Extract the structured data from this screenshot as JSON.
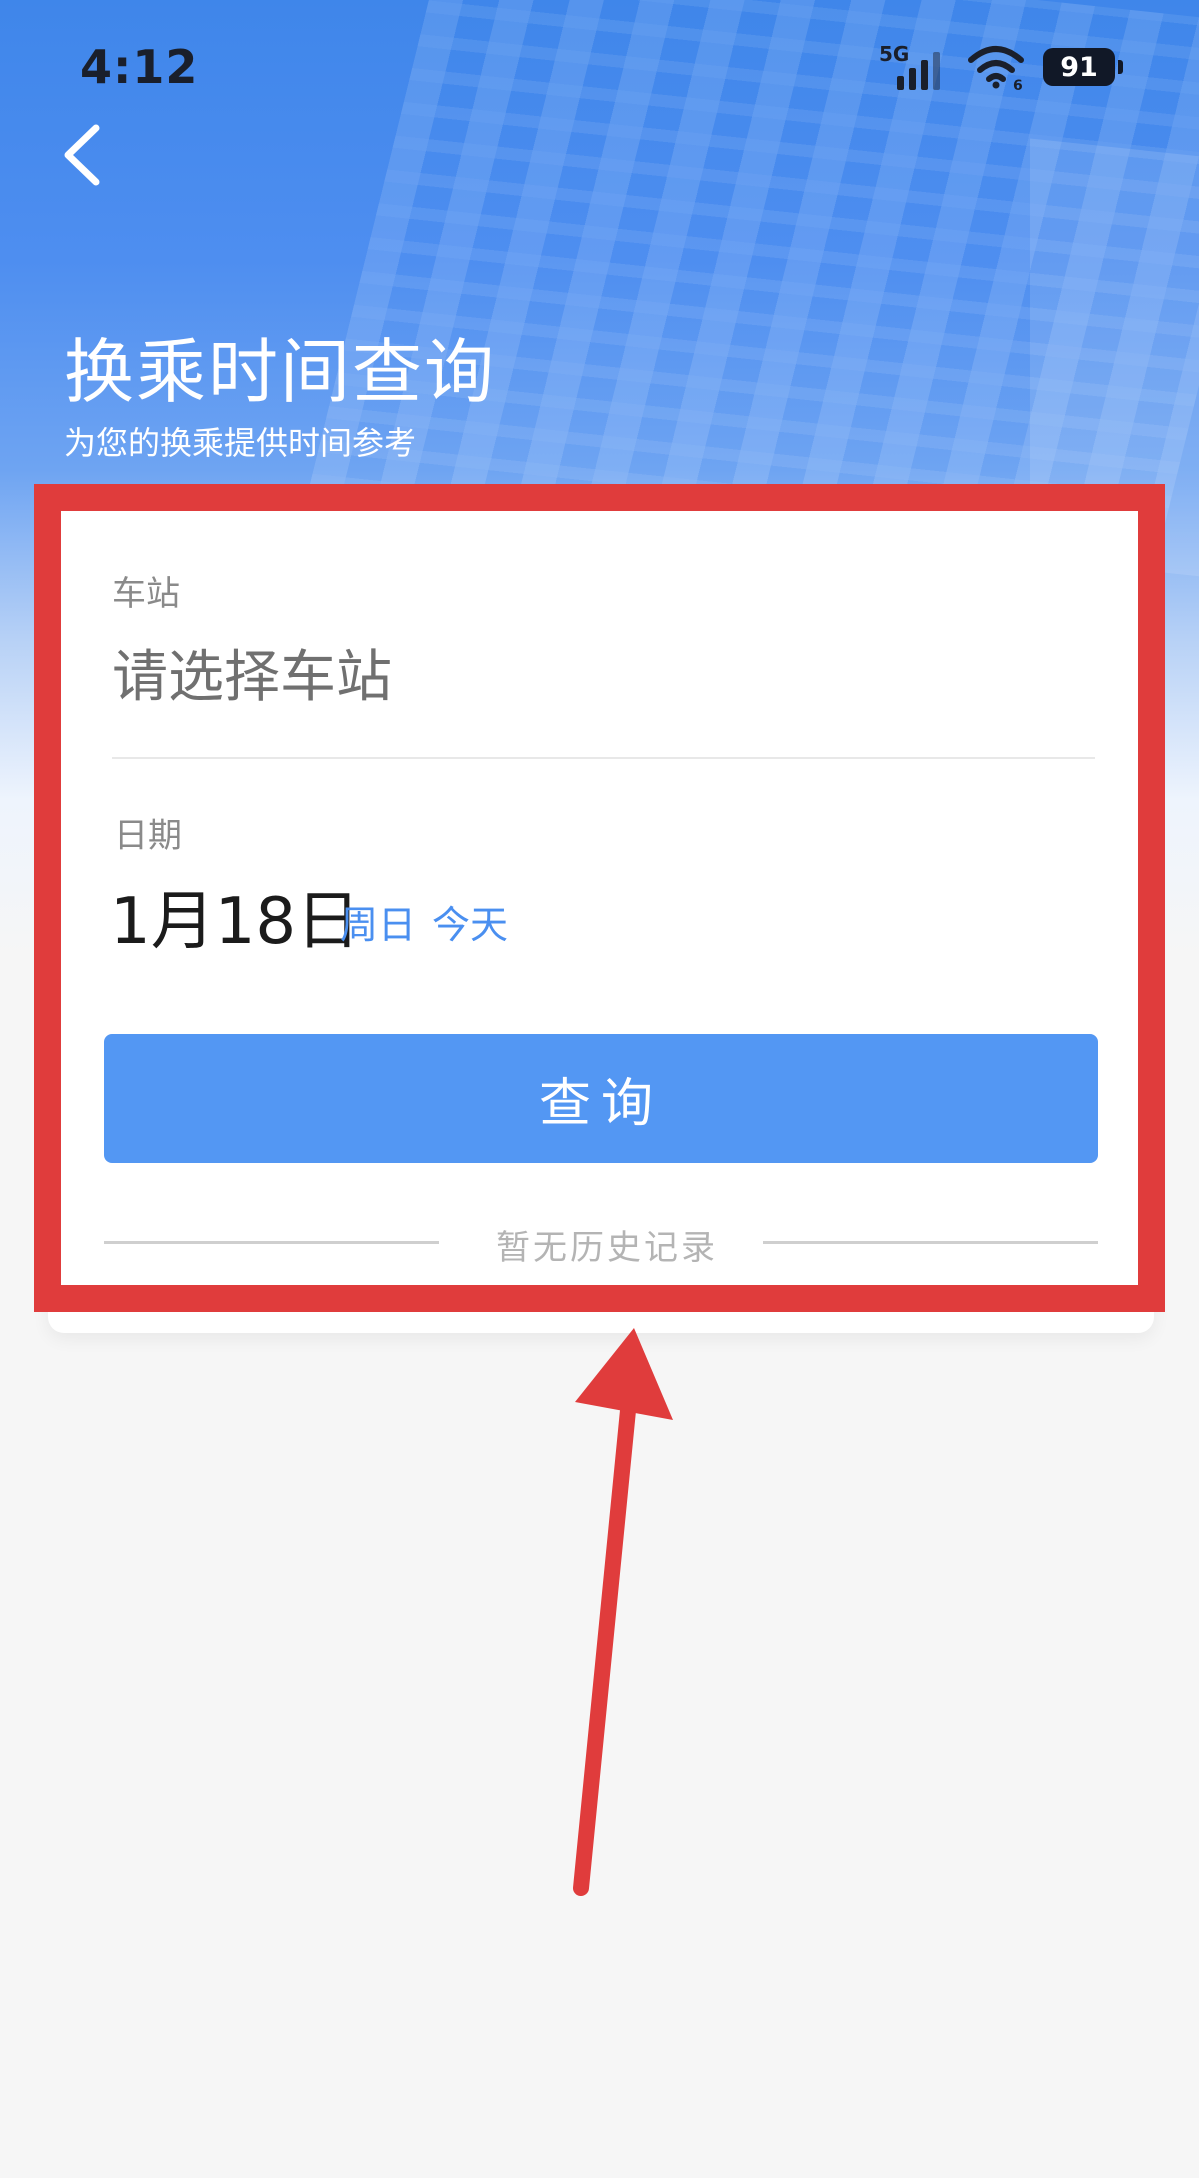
{
  "status_bar": {
    "time": "4:12",
    "network": "5G",
    "battery": "91"
  },
  "header": {
    "title": "换乘时间查询",
    "subtitle": "为您的换乘提供时间参考"
  },
  "form": {
    "station_label": "车站",
    "station_placeholder": "请选择车站",
    "date_label": "日期",
    "date_value": "1月18日",
    "weekday": "周日",
    "today": "今天",
    "query_button": "查询"
  },
  "history": {
    "empty_text": "暂无历史记录"
  },
  "colors": {
    "primary": "#5397f3",
    "accent_text": "#4a8ff0",
    "annotation": "#e03c3c"
  },
  "icons": [
    "back-arrow-icon",
    "signal-icon",
    "wifi-icon",
    "battery-icon",
    "annotation-arrow"
  ]
}
